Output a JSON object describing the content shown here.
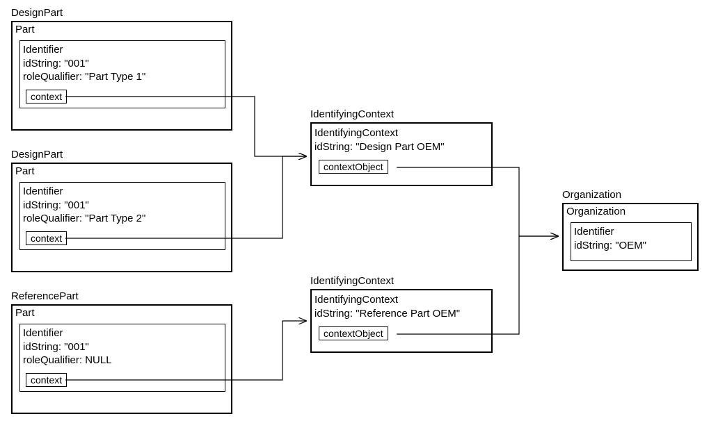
{
  "designPart1": {
    "label": "DesignPart",
    "part": "Part",
    "identifierTitle": "Identifier",
    "idStringLine": "idString: \"001\"",
    "roleQualifierLine": "roleQualifier: \"Part Type 1\"",
    "contextTag": "context"
  },
  "designPart2": {
    "label": "DesignPart",
    "part": "Part",
    "identifierTitle": "Identifier",
    "idStringLine": "idString: \"001\"",
    "roleQualifierLine": "roleQualifier: \"Part Type 2\"",
    "contextTag": "context"
  },
  "referencePart": {
    "label": "ReferencePart",
    "part": "Part",
    "identifierTitle": "Identifier",
    "idStringLine": "idString: \"001\"",
    "roleQualifierLine": "roleQualifier: NULL",
    "contextTag": "context"
  },
  "identifyingContext1": {
    "label": "IdentifyingContext",
    "title": "IdentifyingContext",
    "idStringLine": "idString: \"Design Part OEM\"",
    "tag": "contextObject"
  },
  "identifyingContext2": {
    "label": "IdentifyingContext",
    "title": "IdentifyingContext",
    "idStringLine": "idString: \"Reference Part OEM\"",
    "tag": "contextObject"
  },
  "organization": {
    "label": "Organization",
    "title": "Organization",
    "identifierTitle": "Identifier",
    "idStringLine": "idString: \"OEM\""
  }
}
